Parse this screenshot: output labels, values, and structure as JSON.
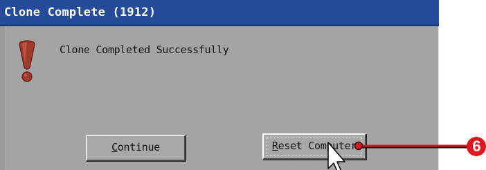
{
  "window": {
    "title": "Clone Complete (1912)"
  },
  "dialog": {
    "icon": "exclamation-icon",
    "message": "Clone Completed Successfully"
  },
  "buttons": {
    "continue": {
      "accel": "C",
      "rest": "ontinue"
    },
    "reset": {
      "accel": "R",
      "rest": "eset Computer"
    }
  },
  "callout": {
    "number": "6",
    "color": "#e0161e"
  },
  "colors": {
    "titlebar": "#244a99",
    "dialog_bg": "#a4a4a4",
    "icon": "#a03a2a"
  }
}
